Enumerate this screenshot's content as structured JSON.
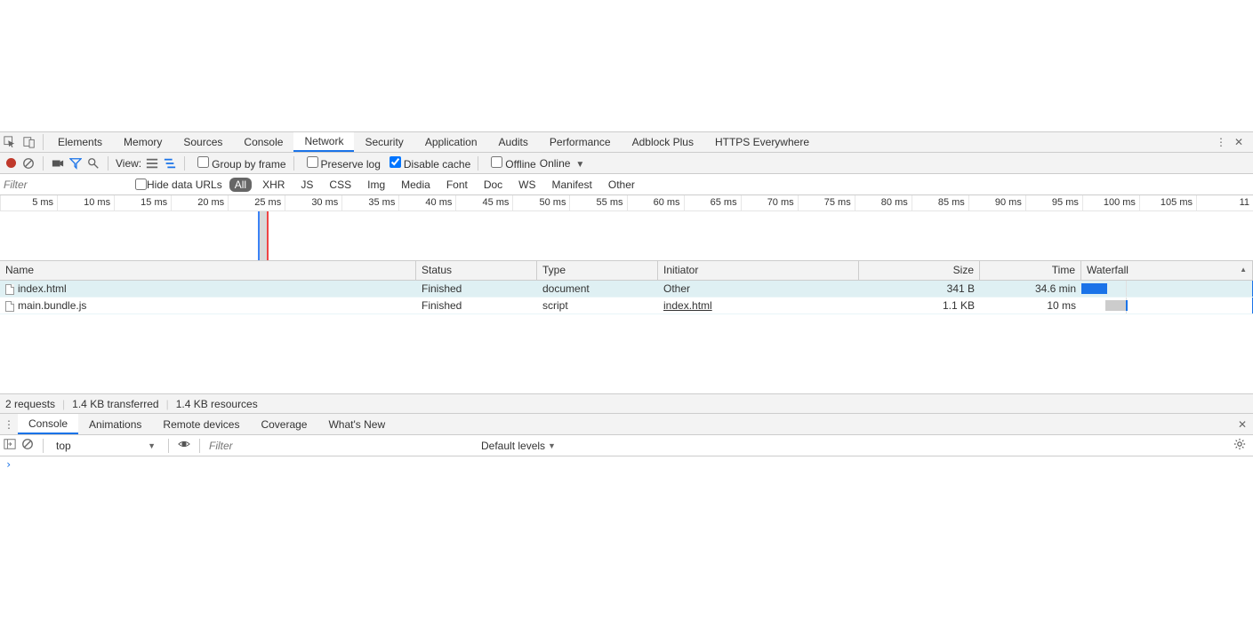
{
  "tabs": {
    "items": [
      "Elements",
      "Memory",
      "Sources",
      "Console",
      "Network",
      "Security",
      "Application",
      "Audits",
      "Performance",
      "Adblock Plus",
      "HTTPS Everywhere"
    ],
    "active_index": 4
  },
  "toolbar": {
    "view_label": "View:",
    "group_by_frame": "Group by frame",
    "preserve_log": "Preserve log",
    "disable_cache": "Disable cache",
    "offline": "Offline",
    "online": "Online",
    "preserve_log_checked": false,
    "disable_cache_checked": true,
    "offline_checked": false
  },
  "filter": {
    "placeholder": "Filter",
    "hide_data_urls": "Hide data URLs",
    "hide_data_urls_checked": false,
    "types": [
      "All",
      "XHR",
      "JS",
      "CSS",
      "Img",
      "Media",
      "Font",
      "Doc",
      "WS",
      "Manifest",
      "Other"
    ],
    "types_active_index": 0
  },
  "timeline": {
    "ticks": [
      "5 ms",
      "10 ms",
      "15 ms",
      "20 ms",
      "25 ms",
      "30 ms",
      "35 ms",
      "40 ms",
      "45 ms",
      "50 ms",
      "55 ms",
      "60 ms",
      "65 ms",
      "70 ms",
      "75 ms",
      "80 ms",
      "85 ms",
      "90 ms",
      "95 ms",
      "100 ms",
      "105 ms",
      "11"
    ]
  },
  "table": {
    "columns": [
      "Name",
      "Status",
      "Type",
      "Initiator",
      "Size",
      "Time",
      "Waterfall"
    ],
    "sort_col_index": 6,
    "rows": [
      {
        "name": "index.html",
        "status": "Finished",
        "type": "document",
        "initiator": "Other",
        "initiator_link": false,
        "size": "341 B",
        "time": "34.6 min",
        "wf": {
          "left_pct": 0,
          "width_pct": 15,
          "style": "blue"
        },
        "selected": true
      },
      {
        "name": "main.bundle.js",
        "status": "Finished",
        "type": "script",
        "initiator": "index.html",
        "initiator_link": true,
        "size": "1.1 KB",
        "time": "10 ms",
        "wf": {
          "left_pct": 14,
          "width_pct": 12,
          "style": "gray-then-blue"
        },
        "selected": false
      }
    ]
  },
  "footer": {
    "requests": "2 requests",
    "transferred": "1.4 KB transferred",
    "resources": "1.4 KB resources"
  },
  "drawer": {
    "tabs": [
      "Console",
      "Animations",
      "Remote devices",
      "Coverage",
      "What's New"
    ],
    "active_index": 0
  },
  "console": {
    "context": "top",
    "filter_placeholder": "Filter",
    "levels": "Default levels",
    "prompt": "›"
  }
}
